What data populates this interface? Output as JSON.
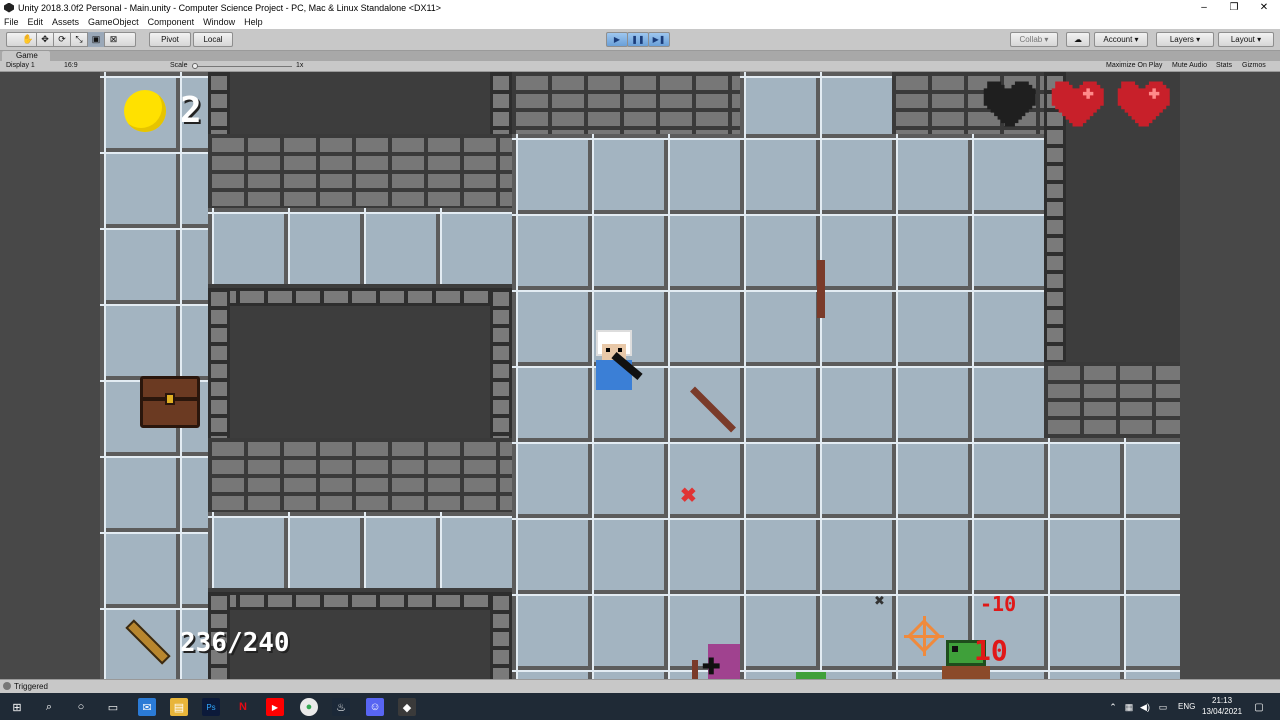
{
  "window": {
    "title": "Unity 2018.3.0f2 Personal - Main.unity - Computer Science Project - PC, Mac & Linux Standalone <DX11>",
    "minimize": "–",
    "maximize": "❐",
    "close": "✕"
  },
  "menu": [
    "File",
    "Edit",
    "Assets",
    "GameObject",
    "Component",
    "Window",
    "Help"
  ],
  "toolbar": {
    "pivot": "Pivot",
    "local": "Local",
    "collab": "Collab ▾",
    "account": "Account",
    "layers": "Layers",
    "layout": "Layout"
  },
  "game_tab": {
    "label": "Game",
    "display": "Display 1",
    "aspect": "16:9",
    "scale_label": "Scale",
    "scale_value": "1x",
    "maximize_on_play": "Maximize On Play",
    "mute_audio": "Mute Audio",
    "stats": "Stats",
    "gizmos": "Gizmos"
  },
  "hud": {
    "coins": "2",
    "ammo": "236/240",
    "hearts": [
      {
        "state": "empty",
        "color": "#1f1f1f"
      },
      {
        "state": "full",
        "color": "#c8202a"
      },
      {
        "state": "full",
        "color": "#c8202a"
      }
    ],
    "damage_1": "-10",
    "damage_2": "10"
  },
  "status": {
    "message": "Triggered"
  },
  "taskbar": {
    "time": "21:13",
    "date": "13/04/2021",
    "language": "ENG"
  },
  "colors": {
    "floor": "#a3b4c1",
    "grout": "#5c5c5c",
    "brick": "#777777",
    "play_active": "#6a9fd8"
  }
}
